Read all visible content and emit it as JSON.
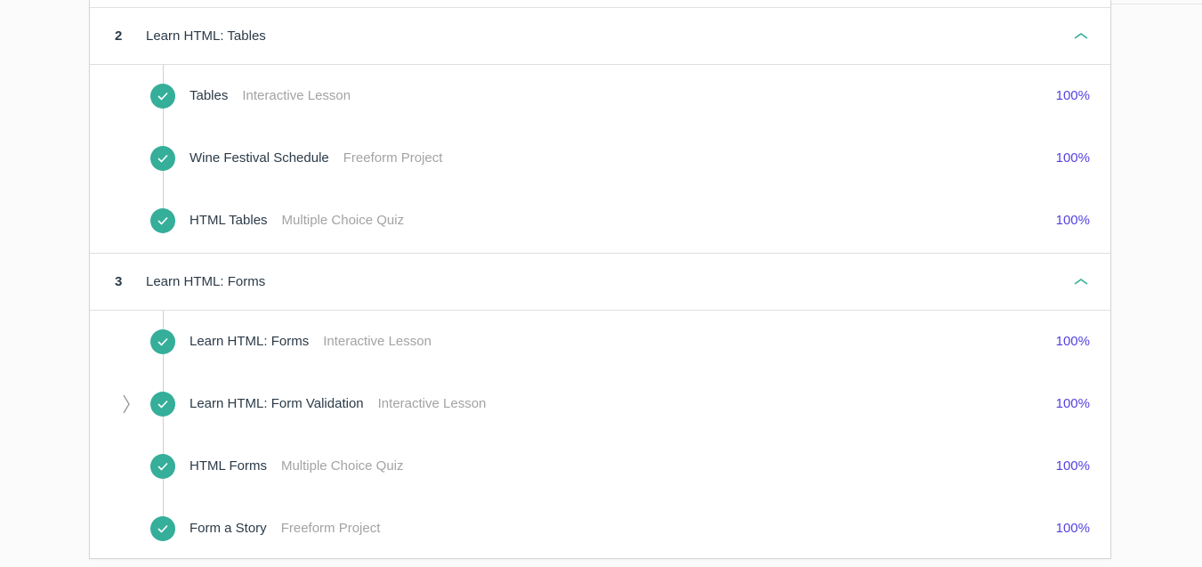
{
  "modules": [
    {
      "number": "2",
      "title": "Learn HTML: Tables",
      "toggle_icon": "chevron-up-icon",
      "lessons": [
        {
          "name": "Tables",
          "type": "Interactive Lesson",
          "progress": "100%",
          "completed": true
        },
        {
          "name": "Wine Festival Schedule",
          "type": "Freeform Project",
          "progress": "100%",
          "completed": true
        },
        {
          "name": "HTML Tables",
          "type": "Multiple Choice Quiz",
          "progress": "100%",
          "completed": true
        }
      ]
    },
    {
      "number": "3",
      "title": "Learn HTML: Forms",
      "toggle_icon": "chevron-up-icon",
      "lessons": [
        {
          "name": "Learn HTML: Forms",
          "type": "Interactive Lesson",
          "progress": "100%",
          "completed": true
        },
        {
          "name": "Learn HTML: Form Validation",
          "type": "Interactive Lesson",
          "progress": "100%",
          "completed": true,
          "current": true
        },
        {
          "name": "HTML Forms",
          "type": "Multiple Choice Quiz",
          "progress": "100%",
          "completed": true
        },
        {
          "name": "Form a Story",
          "type": "Freeform Project",
          "progress": "100%",
          "completed": true
        }
      ]
    }
  ],
  "colors": {
    "complete": "#35ae9a",
    "progress_text": "#5442e0",
    "toggle": "#35ae9a"
  }
}
